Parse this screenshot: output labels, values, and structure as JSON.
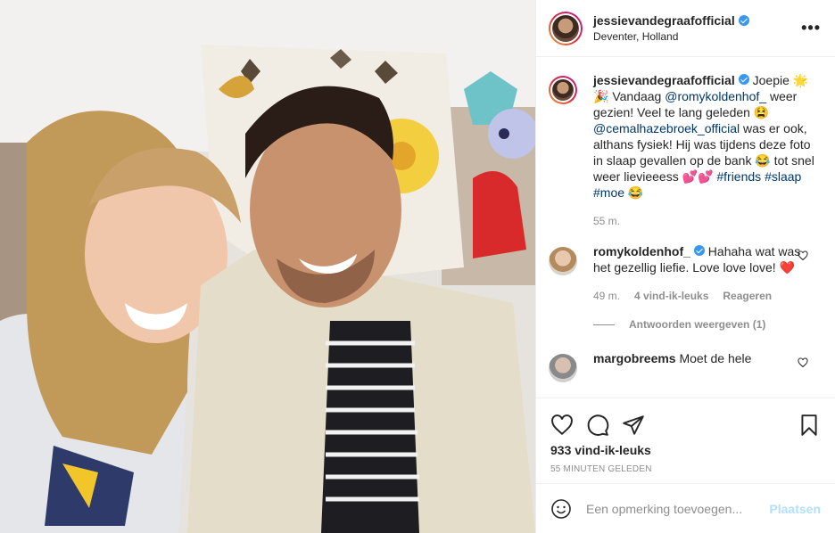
{
  "post": {
    "username": "jessievandegraafofficial",
    "location": "Deventer, Holland",
    "more_glyph": "•••",
    "photo_icon": "photo",
    "verified_icon": "verified-badge-icon"
  },
  "caption": {
    "username": "jessievandegraafofficial",
    "text_1": " Joepie 🌟🎉 Vandaag ",
    "mention_1": "@romykoldenhof_",
    "text_2": " weer gezien! Veel te lang geleden 😫 ",
    "mention_2": "@cemalhazebroek_official",
    "text_3": " was er ook, althans fysiek! Hij was tijdens deze foto in slaap gevallen op de bank 😂 tot snel weer lievieeess 💕💕 ",
    "hashtag_1": "#friends",
    "hashtag_2": "#slaap",
    "hashtag_3": "#moe",
    "text_4": " 😂",
    "time": "55 m."
  },
  "comments": [
    {
      "username": "romykoldenhof_",
      "text": " Hahaha wat was het gezellig liefie. Love love love! ❤️",
      "time": "49 m.",
      "likes": "4 vind-ik-leuks",
      "reply": "Reageren",
      "view_replies": "Antwoorden weergeven (1)"
    },
    {
      "username": "margobreems",
      "text": " Moet de hele"
    }
  ],
  "actions": {
    "likes": "933 vind-ik-leuks",
    "timestamp": "55 MINUTEN GELEDEN"
  },
  "add_comment": {
    "placeholder": "Een opmerking toevoegen...",
    "post_label": "Plaatsen"
  },
  "colors": {
    "link": "#00376b",
    "secondary": "#8e8e8e",
    "post_button": "#b2dffc",
    "verified": "#3897f0",
    "heart": "#ed4956"
  }
}
